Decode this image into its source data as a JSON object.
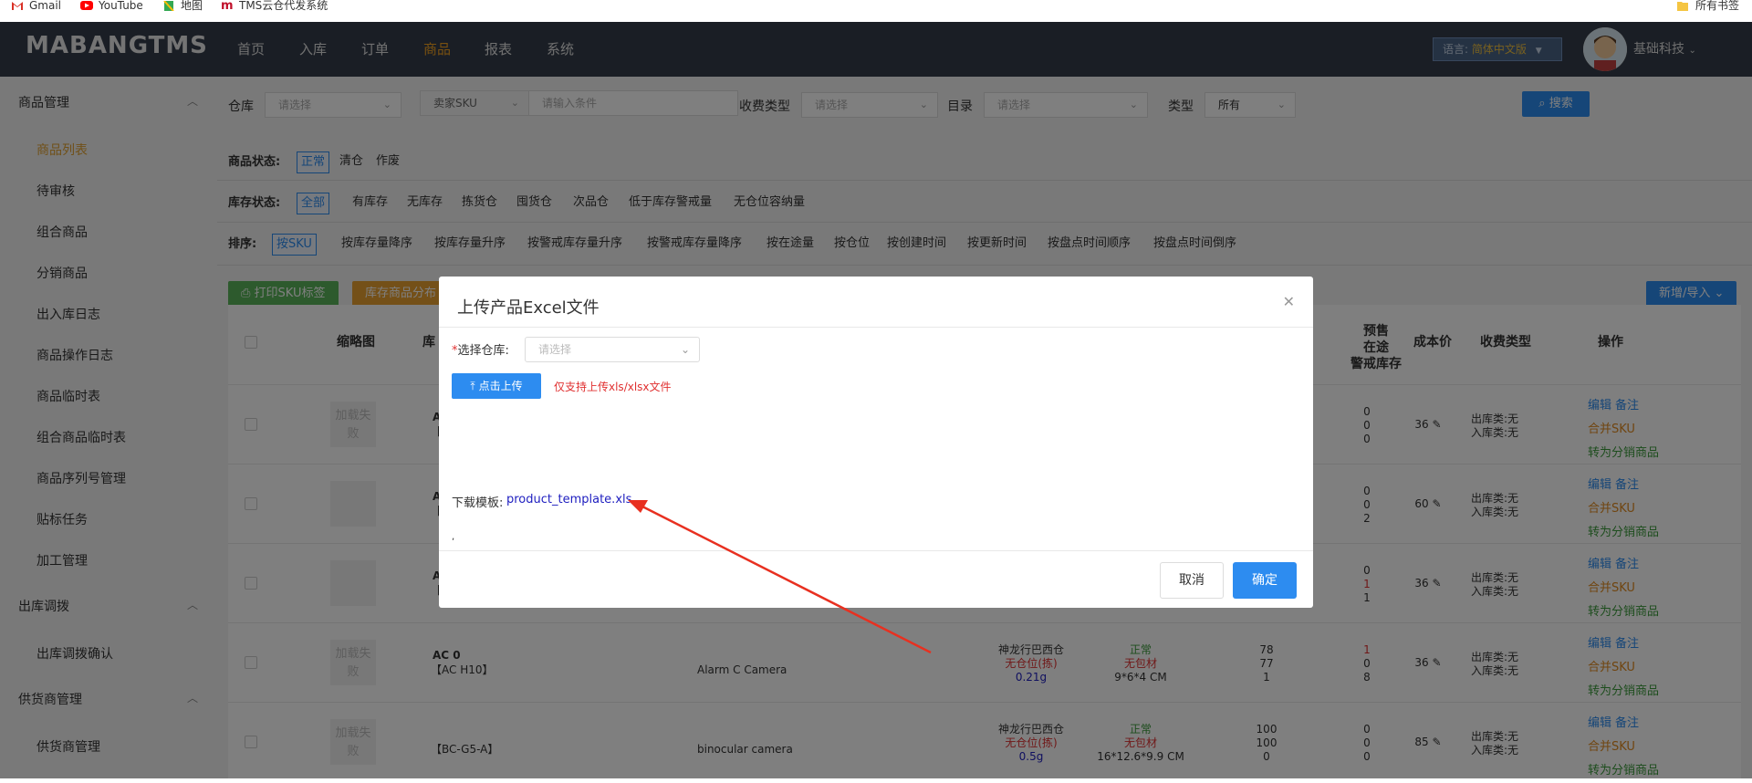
{
  "bookmarks": [
    {
      "label": "Gmail",
      "icon": "gmail-icon"
    },
    {
      "label": "YouTube",
      "icon": "youtube-icon"
    },
    {
      "label": "地图",
      "icon": "maps-icon"
    },
    {
      "label": "TMS云仓代发系统",
      "icon": "tms-icon"
    }
  ],
  "bookmarks_right": "所有书签",
  "header": {
    "logo": "MABANGTMS",
    "nav": [
      "首页",
      "入库",
      "订单",
      "商品",
      "报表",
      "系统"
    ],
    "active_nav": "商品",
    "language_label": "语言:",
    "language_value": "简体中文版",
    "username": "基础科技"
  },
  "sidebar": {
    "groups": [
      {
        "label": "商品管理",
        "items": [
          "商品列表",
          "待审核",
          "组合商品",
          "分销商品",
          "出入库日志",
          "商品操作日志",
          "商品临时表",
          "组合商品临时表",
          "商品序列号管理",
          "贴标任务",
          "加工管理"
        ]
      },
      {
        "label": "出库调拨",
        "items": [
          "出库调拨确认"
        ]
      },
      {
        "label": "供货商管理",
        "items": [
          "供货商管理"
        ]
      }
    ],
    "active_item": "商品列表"
  },
  "filters": {
    "warehouse_label": "仓库",
    "warehouse_placeholder": "请选择",
    "sku_type": "卖家SKU",
    "sku_placeholder": "请输入条件",
    "charge_label": "收费类型",
    "charge_placeholder": "请选择",
    "catalog_label": "目录",
    "catalog_placeholder": "请选择",
    "type_label": "类型",
    "type_value": "所有",
    "search_label": "搜索"
  },
  "status_rows": {
    "product_status": {
      "label": "商品状态:",
      "options": [
        "正常",
        "清仓",
        "作废"
      ],
      "active": 0
    },
    "stock_status": {
      "label": "库存状态:",
      "options": [
        "全部",
        "有库存",
        "无库存",
        "拣货仓",
        "囤货仓",
        "次品仓",
        "低于库存警戒量",
        "无仓位容纳量"
      ],
      "active": 0
    },
    "sort": {
      "label": "排序:",
      "options": [
        "按SKU",
        "按库存量降序",
        "按库存量升序",
        "按警戒库存量升序",
        "按警戒库存量降序",
        "按在途量",
        "按仓位",
        "按创建时间",
        "按更新时间",
        "按盘点时间顺序",
        "按盘点时间倒序"
      ],
      "active": 0
    }
  },
  "actions": {
    "print_label": "打印SKU标签",
    "distribution_label": "库存商品分布",
    "add_import_label": "新增/导入"
  },
  "table": {
    "headers": {
      "thumb": "缩略图",
      "sku": "库",
      "forecast": [
        "预售",
        "在途",
        "警戒库存"
      ],
      "cost": "成本价",
      "charge": "收费类型",
      "op": "操作"
    },
    "rows": [
      {
        "thumb_text": "加载失败",
        "sku": "A",
        "sku_sub": "【",
        "name": "",
        "name2": "",
        "warehouse": "",
        "wh_pos": "",
        "weight": "",
        "status": "",
        "packing": "",
        "size": "",
        "stock": [
          "",
          "",
          ""
        ],
        "forecast": [
          "0",
          "0",
          "0"
        ],
        "cost": "36",
        "charge": [
          "出库类:无",
          "入库类:无"
        ],
        "actions": [
          "编辑",
          "备注",
          "合并SKU",
          "转为分销商品"
        ]
      },
      {
        "thumb_text": "",
        "sku": "A",
        "sku_sub": "【",
        "name": "",
        "name2": "",
        "warehouse": "",
        "wh_pos": "",
        "weight": "",
        "status": "",
        "packing": "",
        "size": "",
        "stock": [
          "",
          "",
          ""
        ],
        "forecast": [
          "0",
          "0",
          "2"
        ],
        "cost": "60",
        "charge": [
          "出库类:无",
          "入库类:无"
        ],
        "actions": [
          "编辑",
          "备注",
          "合并SKU",
          "转为分销商品"
        ]
      },
      {
        "thumb_text": "",
        "sku": "A",
        "sku_sub": "【",
        "name": "",
        "name2": "",
        "warehouse": "",
        "wh_pos": "",
        "weight": "",
        "status": "",
        "packing": "",
        "size": "",
        "stock": [
          "",
          "",
          ""
        ],
        "forecast": [
          "0",
          "1",
          "1"
        ],
        "cost": "36",
        "charge": [
          "出库类:无",
          "入库类:无"
        ],
        "actions": [
          "编辑",
          "备注",
          "合并SKU",
          "转为分销商品"
        ]
      },
      {
        "thumb_text": "加载失败",
        "sku": "AC 0",
        "sku_sub": "【AC H10】",
        "name": "",
        "name2": "Alarm C Camera",
        "warehouse": "神龙行巴西仓",
        "wh_pos": "无仓位(拣)",
        "weight": "0.21g",
        "status": "正常",
        "packing": "无包材",
        "size": "9*6*4 CM",
        "stock": [
          "78",
          "77",
          "1"
        ],
        "forecast": [
          "1",
          "0",
          "8"
        ],
        "cost": "36",
        "charge": [
          "出库类:无",
          "入库类:无"
        ],
        "actions": [
          "编辑",
          "备注",
          "合并SKU",
          "转为分销商品"
        ]
      },
      {
        "thumb_text": "加载失败",
        "sku": "",
        "sku_sub": "【BC-G5-A】",
        "name": "",
        "name2": "binocular camera",
        "warehouse": "神龙行巴西仓",
        "wh_pos": "无仓位(拣)",
        "weight": "0.5g",
        "status": "正常",
        "packing": "无包材",
        "size": "16*12.6*9.9 CM",
        "stock": [
          "100",
          "100",
          "0"
        ],
        "forecast": [
          "0",
          "0",
          "0"
        ],
        "cost": "85",
        "charge": [
          "出库类:无",
          "入库类:无"
        ],
        "actions": [
          "编辑",
          "备注",
          "合并SKU",
          "转为分销商品"
        ]
      }
    ]
  },
  "dialog": {
    "title": "上传产品Excel文件",
    "warehouse_label": "*选择仓库:",
    "warehouse_placeholder": "请选择",
    "upload_label": "点击上传",
    "upload_tip": "仅支持上传xls/xlsx文件",
    "template_label": "下载模板:",
    "template_link": "product_template.xls",
    "dot": ",",
    "cancel_label": "取消",
    "ok_label": "确定"
  },
  "colors": {
    "primary": "#2d8cf0",
    "header_bg": "#353d4a",
    "active_nav": "#f0a020",
    "green": "#3a9a3a",
    "orange": "#e08a20",
    "annotation": "#e83020"
  }
}
